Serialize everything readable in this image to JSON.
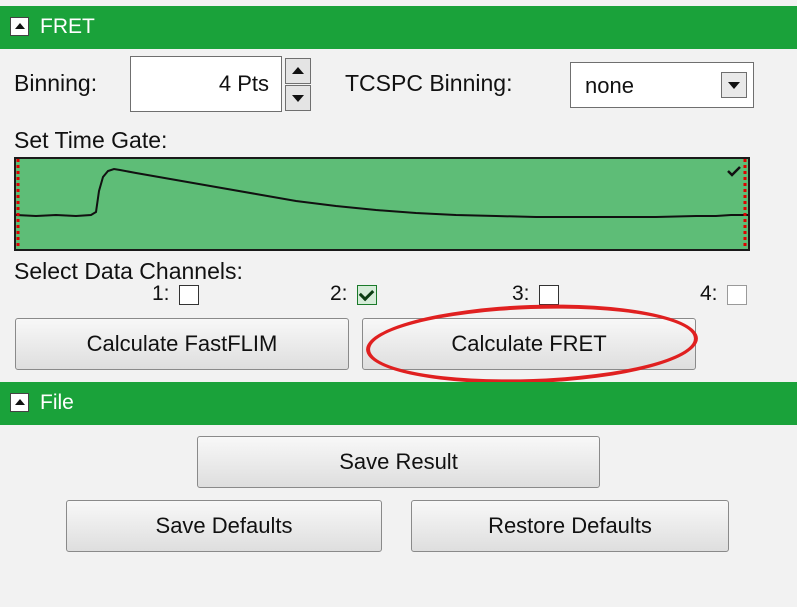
{
  "fret_panel": {
    "header_label": "FRET",
    "binning_label": "Binning:",
    "binning_value": "4 Pts",
    "tcspc_label": "TCSPC Binning:",
    "tcspc_value": "none",
    "time_gate_label": "Set Time Gate:",
    "select_channels_label": "Select Data Channels:",
    "channels": [
      {
        "label": "1:",
        "checked": false
      },
      {
        "label": "2:",
        "checked": true
      },
      {
        "label": "3:",
        "checked": false
      },
      {
        "label": "4:",
        "checked": false
      }
    ],
    "calc_fastflim_label": "Calculate FastFLIM",
    "calc_fret_label": "Calculate FRET"
  },
  "file_panel": {
    "header_label": "File",
    "save_result_label": "Save Result",
    "save_defaults_label": "Save Defaults",
    "restore_defaults_label": "Restore Defaults"
  },
  "colors": {
    "header_green": "#1aa23a",
    "gate_fill": "#5ebd77",
    "highlight_red": "#e02020",
    "marker_red": "#e00000"
  },
  "icons": {
    "collapse": "triangle-up-icon",
    "spin_up": "triangle-up-icon",
    "spin_down": "triangle-down-icon",
    "dropdown": "chevron-down-icon",
    "gate_marker": "check-icon"
  }
}
